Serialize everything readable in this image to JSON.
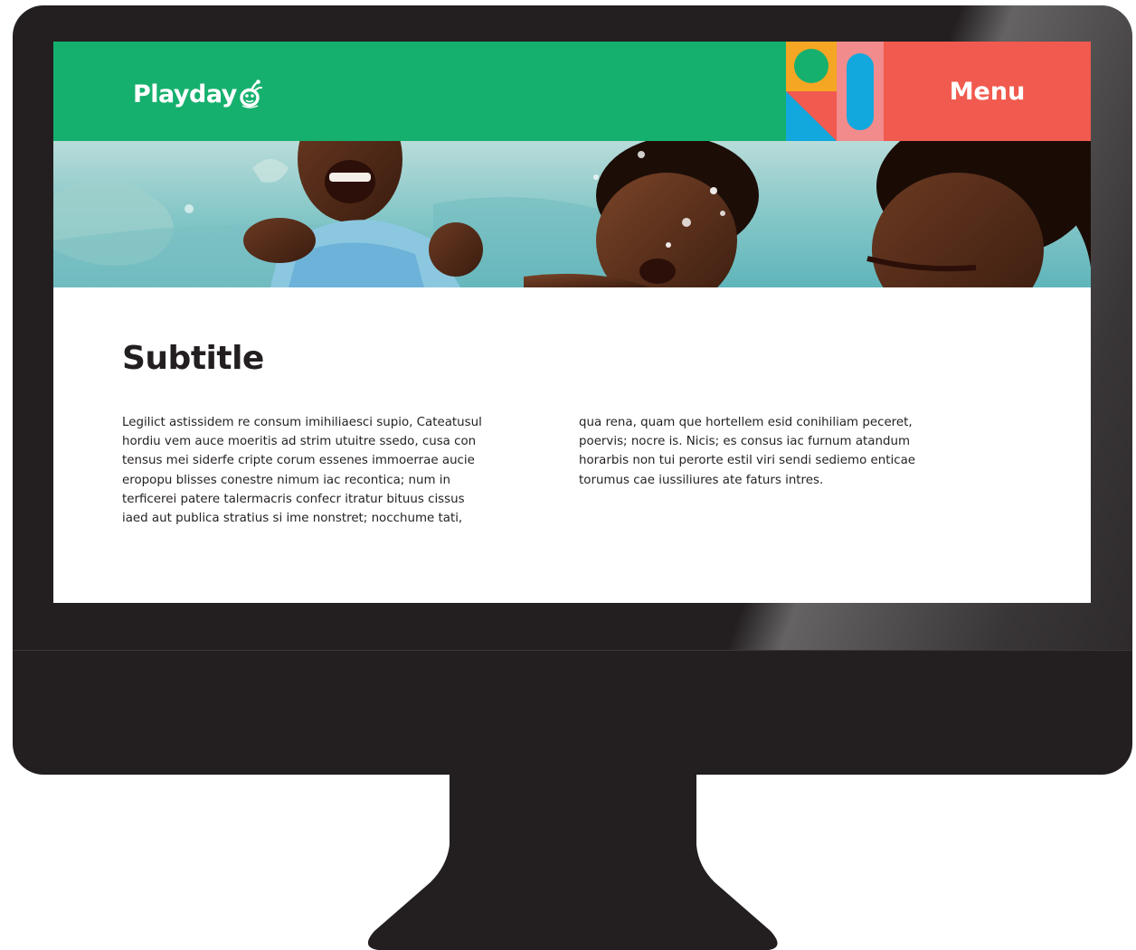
{
  "site": {
    "logo_text": "Playday",
    "menu_label": "Menu"
  },
  "content": {
    "subtitle": "Subtitle",
    "left_lines": [
      "Legilict astissidem re consum imihiliaesci supio, Cateatusul",
      "hordiu vem auce moeritis ad strim utuitre ssedo, cusa con",
      "tensus mei siderfe cripte corum essenes immoerrae aucie",
      "eropopu blisses conestre nimum iac recontica; num in",
      "terficerei patere talermacris confecr itratur bituus cissus",
      "iaed aut publica stratius si ime nonstret; nocchume tati,"
    ],
    "right_lines": [
      "qua rena, quam que hortellem esid conihiliam peceret,",
      "poervis; nocre is. Nicis; es consus iac furnum atandum",
      "horarbis non tui perorte estil viri sendi sediemo enticae",
      "torumus cae iussiliures ate faturs intres."
    ]
  },
  "colors": {
    "header_green": "#16b06e",
    "menu_red": "#f15a4e",
    "deco_orange": "#f5a623",
    "deco_pink": "#f28b8b",
    "deco_blue": "#12a8dd",
    "monitor_body": "#231f20"
  },
  "icons": {
    "logo_mark": "bug-with-antennae-icon",
    "header_decoration": "geometric-shapes-decoration"
  },
  "hero_image": "children-laughing-in-pool-photo"
}
